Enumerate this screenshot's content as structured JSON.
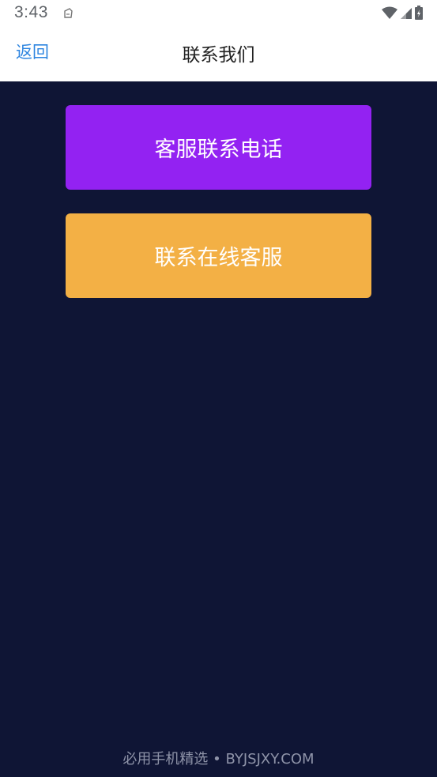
{
  "status_bar": {
    "time": "3:43"
  },
  "nav": {
    "back_label": "返回",
    "title": "联系我们"
  },
  "buttons": {
    "phone_label": "客服联系电话",
    "online_label": "联系在线客服"
  },
  "footer": {
    "text": "必用手机精选 • BYJSJXY.COM"
  },
  "colors": {
    "background": "#0f1535",
    "phone_button": "#9322f2",
    "online_button": "#f3b045",
    "accent": "#2f86e0"
  },
  "icons": {
    "notification": "clipboard-icon",
    "wifi": "wifi-icon",
    "signal": "cell-signal-icon",
    "battery": "battery-icon"
  }
}
